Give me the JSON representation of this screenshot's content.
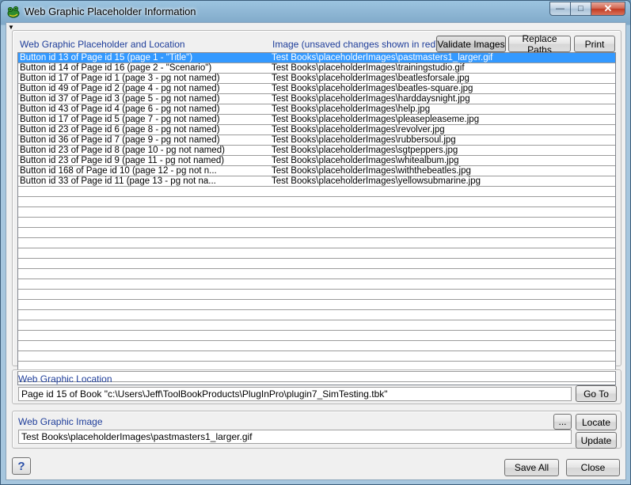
{
  "window": {
    "title": "Web Graphic Placeholder Information",
    "caption_minimize": "—",
    "caption_maximize": "□",
    "caption_close": "✕"
  },
  "menu_arrow": "▼",
  "list_section": {
    "location_header": "Web Graphic Placeholder and Location",
    "image_header": "Image (unsaved changes shown in red)",
    "validate_label": "Validate Images",
    "replace_label": "Replace Paths",
    "print_label": "Print"
  },
  "rows": [
    {
      "loc": "Button id 13 of Page id 15 (page 1 - \"Title\")",
      "img": "Test Books\\placeholderImages\\pastmasters1_larger.gif"
    },
    {
      "loc": "Button id 14 of Page id 16 (page 2 - \"Scenario\")",
      "img": "Test Books\\placeholderImages\\trainingstudio.gif"
    },
    {
      "loc": "Button id 17 of Page id 1 (page 3 - pg not named)",
      "img": "Test Books\\placeholderImages\\beatlesforsale.jpg"
    },
    {
      "loc": "Button id 49 of Page id 2 (page 4 - pg not named)",
      "img": "Test Books\\placeholderImages\\beatles-square.jpg"
    },
    {
      "loc": "Button id 37 of Page id 3 (page 5 - pg not named)",
      "img": "Test Books\\placeholderImages\\harddaysnight.jpg"
    },
    {
      "loc": "Button id 43 of Page id 4 (page 6 - pg not named)",
      "img": "Test Books\\placeholderImages\\help.jpg"
    },
    {
      "loc": "Button id 17 of Page id 5 (page 7 - pg not named)",
      "img": "Test Books\\placeholderImages\\pleasepleaseme.jpg"
    },
    {
      "loc": "Button id 23 of Page id 6 (page 8 - pg not named)",
      "img": "Test Books\\placeholderImages\\revolver.jpg"
    },
    {
      "loc": "Button id 36 of Page id 7 (page 9 - pg not named)",
      "img": "Test Books\\placeholderImages\\rubbersoul.jpg"
    },
    {
      "loc": "Button id 23 of Page id 8 (page 10 - pg not named)",
      "img": "Test Books\\placeholderImages\\sgtpeppers.jpg"
    },
    {
      "loc": "Button id 23 of Page id 9 (page 11 - pg not named)",
      "img": "Test Books\\placeholderImages\\whitealbum.jpg"
    },
    {
      "loc": "Button id 168 of Page id 10 (page 12 - pg not n...",
      "img": "Test Books\\placeholderImages\\withthebeatles.jpg"
    },
    {
      "loc": "Button id 33 of Page id 11 (page 13 - pg not na...",
      "img": "Test Books\\placeholderImages\\yellowsubmarine.jpg"
    }
  ],
  "location_section": {
    "header": "Web Graphic Location",
    "value": "Page id 15 of Book \"c:\\Users\\Jeff\\ToolBookProducts\\PlugInPro\\plugin7_SimTesting.tbk\"",
    "goto_label": "Go To"
  },
  "image_section": {
    "header": "Web Graphic Image",
    "value": "Test Books\\placeholderImages\\pastmasters1_larger.gif",
    "browse_label": "...",
    "locate_label": "Locate",
    "update_label": "Update"
  },
  "footer": {
    "help_label": "?",
    "save_all_label": "Save All",
    "close_label": "Close"
  },
  "colors": {
    "header_text": "#1f3e9a",
    "selection": "#3399ff"
  }
}
